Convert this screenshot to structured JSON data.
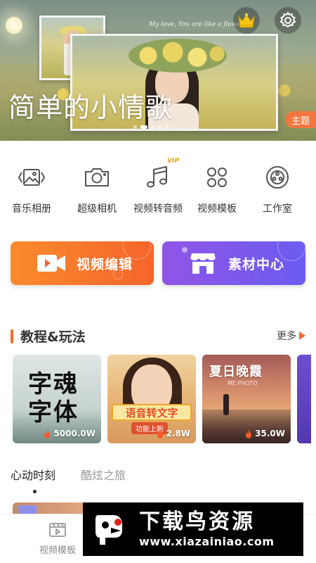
{
  "banner": {
    "title_art": "简单的小情歌",
    "deco_text": "My love, You are like a flower...",
    "theme_tag": "主题",
    "dots": 5,
    "active_dot": 1
  },
  "quick_functions": [
    {
      "label": "音乐相册",
      "icon": "image-album-icon"
    },
    {
      "label": "超级相机",
      "icon": "camera-icon"
    },
    {
      "label": "视频转音频",
      "icon": "music-note-icon",
      "badge": "VIP"
    },
    {
      "label": "视频模板",
      "icon": "clover-template-icon"
    },
    {
      "label": "工作室",
      "icon": "film-reel-icon"
    }
  ],
  "cards": {
    "video_edit": {
      "label": "视频编辑",
      "icon": "video-camera-icon"
    },
    "material_center": {
      "label": "素材中心",
      "icon": "store-icon"
    }
  },
  "tutorials": {
    "title": "教程&玩法",
    "more_label": "更多",
    "items": [
      {
        "art_text": "字魂字体",
        "views": "5000.0W"
      },
      {
        "art_text": "语音转文字",
        "art_sub": "功能上新",
        "views": "2.8W"
      },
      {
        "art_text": "夏日晚霞",
        "art_sub": "ME PHOTO",
        "views": "35.0W"
      }
    ]
  },
  "feed_tabs": [
    "心动时刻",
    "酷炫之旅"
  ],
  "bottom_nav": {
    "label": "视频模板"
  },
  "watermark": {
    "title": "下载鸟资源",
    "url": "www.xiazainiao.com"
  },
  "colors": {
    "accent_orange": "#f36a2b",
    "card_orange": "#fb8a2c",
    "card_purple": "#8f55e7",
    "theme_tag": "#f2763f",
    "vip_gold": "#e5a21a"
  }
}
